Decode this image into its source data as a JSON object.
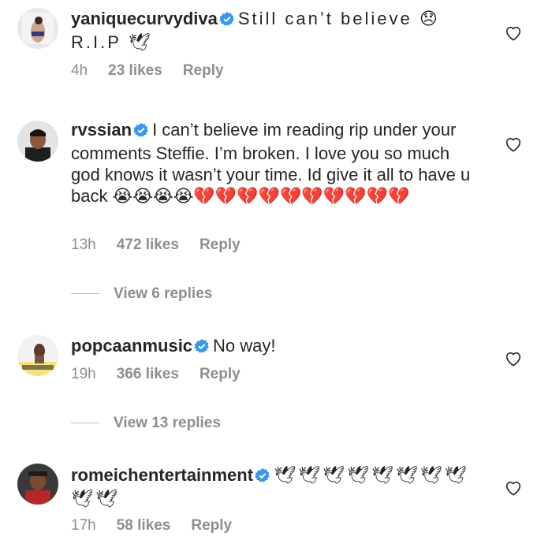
{
  "comments": [
    {
      "username": "yaniquecurvydiva",
      "text": "Still can’t believe 😞 R.I.P 🕊",
      "time": "4h",
      "likes": "23 likes",
      "reply": "Reply"
    },
    {
      "username": "rvssian",
      "text": "I can’t believe im reading rip under your comments Steffie. I’m broken. I love you so much god knows it wasn’t your time. Id give it all to have u back 😭😭😭😭💔💔💔💔💔💔💔💔💔💔",
      "time": "13h",
      "likes": "472 likes",
      "reply": "Reply",
      "view_replies": "View 6 replies"
    },
    {
      "username": "popcaanmusic",
      "text": "No way!",
      "time": "19h",
      "likes": "366 likes",
      "reply": "Reply",
      "view_replies": "View 13 replies"
    },
    {
      "username": "romeichentertainment",
      "text": "🕊🕊🕊🕊🕊🕊🕊🕊🕊🕊",
      "time": "17h",
      "likes": "58 likes",
      "reply": "Reply"
    }
  ],
  "colors": {
    "text": "#262626",
    "meta": "#8e8e8e",
    "verified": "#3897f0"
  },
  "icons": {
    "verified": "verified-badge-icon",
    "like": "heart-outline-icon"
  }
}
